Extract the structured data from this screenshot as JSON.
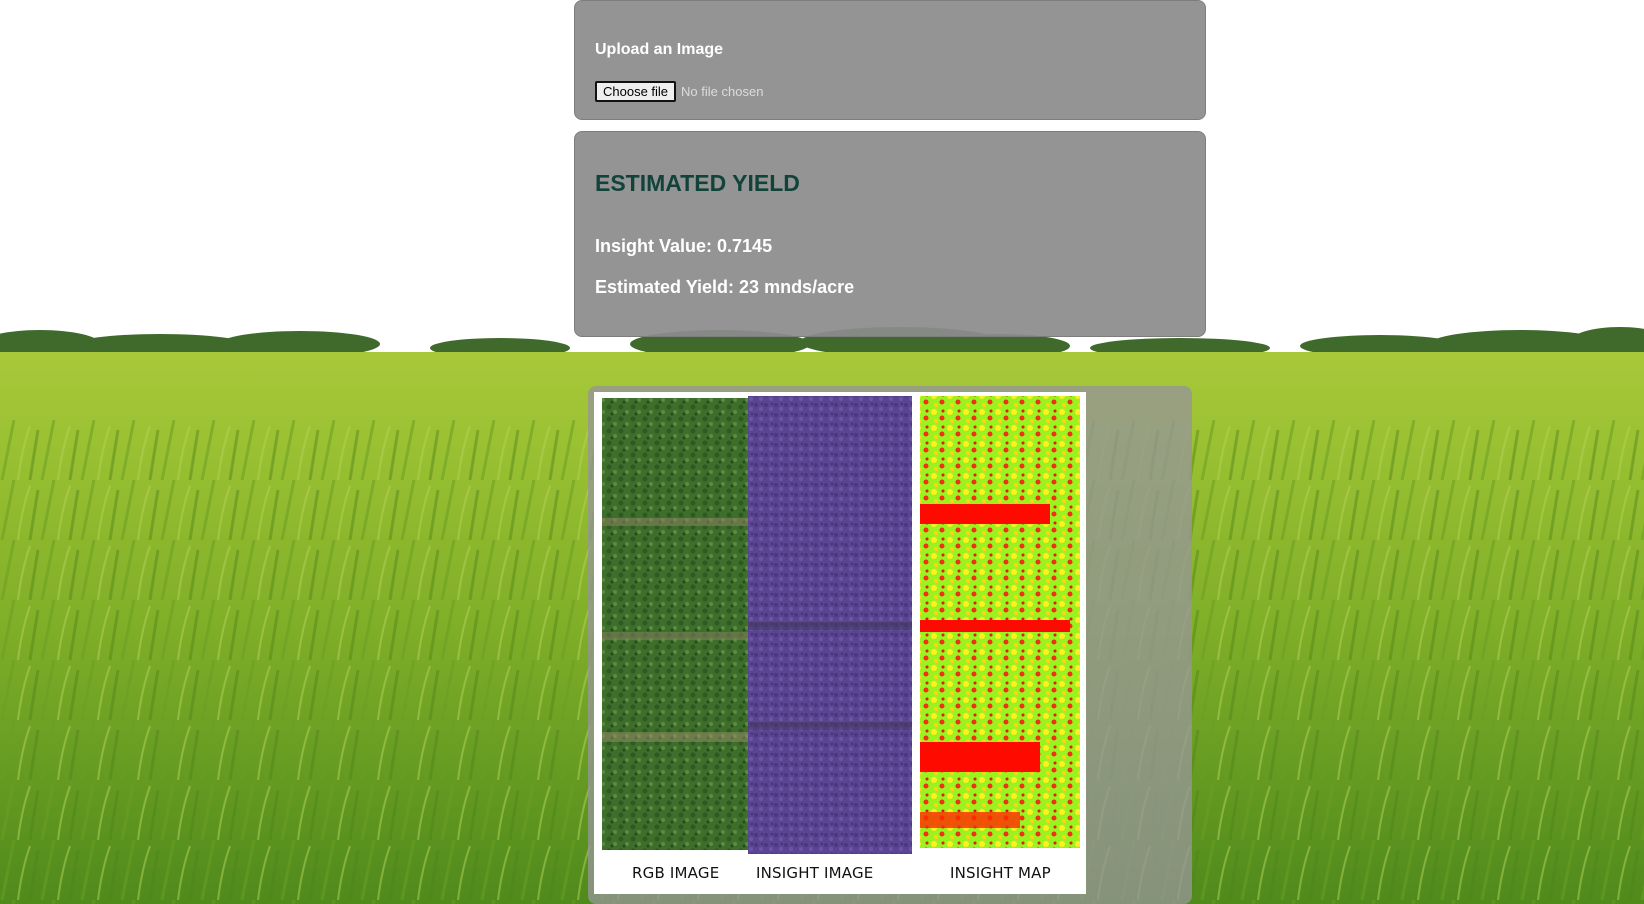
{
  "upload": {
    "title": "Upload an Image",
    "button_label": "Choose file",
    "status": "No file chosen"
  },
  "result": {
    "title": "ESTIMATED YIELD",
    "insight_value_text": "Insight Value: 0.7145",
    "estimated_yield_text": "Estimated Yield: 23 mnds/acre"
  },
  "figure": {
    "labels": [
      "RGB IMAGE",
      "INSIGHT IMAGE",
      "INSIGHT MAP"
    ]
  },
  "colors": {
    "title_color": "#12433b",
    "panel_gray": "#8c8c8c"
  }
}
